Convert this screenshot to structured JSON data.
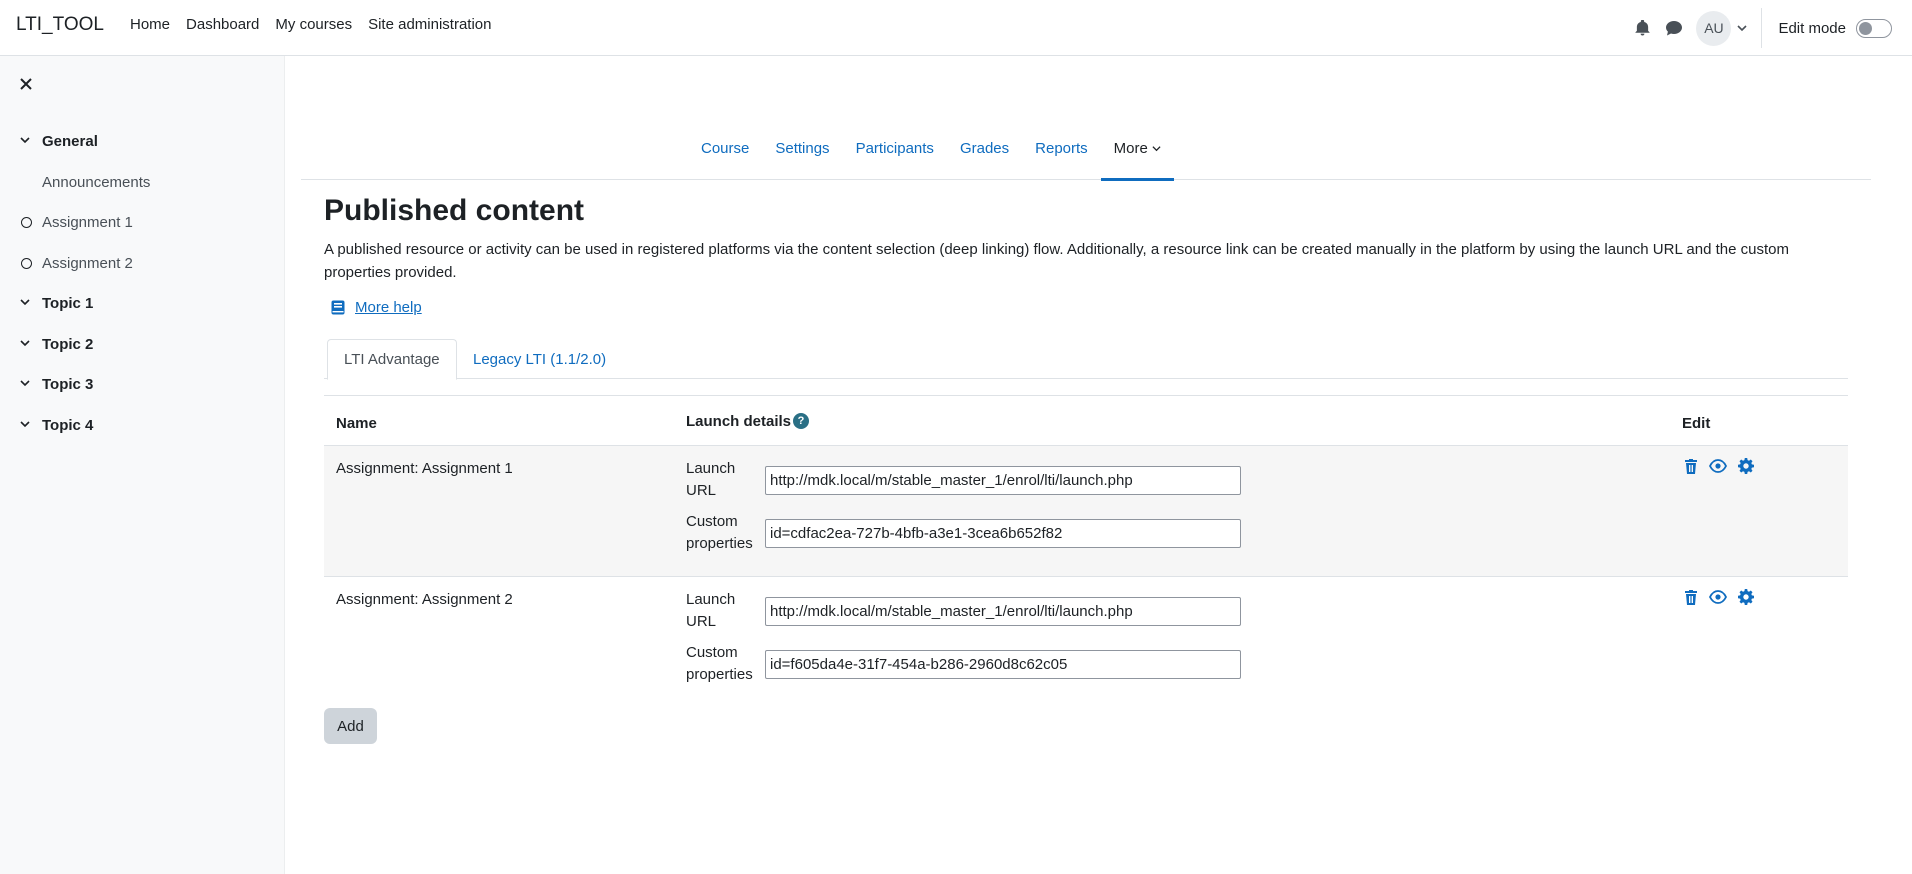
{
  "navbar": {
    "brand": "LTI_TOOL",
    "links": [
      "Home",
      "Dashboard",
      "My courses",
      "Site administration"
    ],
    "avatar_initials": "AU",
    "edit_mode_label": "Edit mode"
  },
  "drawer": {
    "sections": [
      {
        "label": "General"
      },
      {
        "label": "Topic 1"
      },
      {
        "label": "Topic 2"
      },
      {
        "label": "Topic 3"
      },
      {
        "label": "Topic 4"
      }
    ],
    "general_items": [
      "Announcements",
      "Assignment 1",
      "Assignment 2"
    ]
  },
  "secondary_nav": {
    "tabs": [
      "Course",
      "Settings",
      "Participants",
      "Grades",
      "Reports"
    ],
    "more_label": "More"
  },
  "page": {
    "title": "Published content",
    "description": "A published resource or activity can be used in registered platforms via the content selection (deep linking) flow. Additionally, a resource link can be created manually in the platform by using the launch URL and the custom properties provided.",
    "help_link": "More help"
  },
  "tabs": {
    "active": "LTI Advantage",
    "inactive": "Legacy LTI (1.1/2.0)"
  },
  "table": {
    "headers": {
      "name": "Name",
      "launch": "Launch details",
      "edit": "Edit"
    },
    "info_glyph": "?",
    "launch_url_label": "Launch URL",
    "custom_props_label": "Custom properties",
    "rows": [
      {
        "name": "Assignment: Assignment 1",
        "launch_url": "http://mdk.local/m/stable_master_1/enrol/lti/launch.php",
        "custom_properties": "id=cdfac2ea-727b-4bfb-a3e1-3cea6b652f82"
      },
      {
        "name": "Assignment: Assignment 2",
        "launch_url": "http://mdk.local/m/stable_master_1/enrol/lti/launch.php",
        "custom_properties": "id=f605da4e-31f7-454a-b286-2960d8c62c05"
      }
    ]
  },
  "add_button": "Add",
  "colors": {
    "accent": "#0f6cbf",
    "drawer_bg": "#f8f9fa",
    "row_bg": "#f6f6f6"
  },
  "icons": [
    "bell-icon",
    "chat-icon",
    "close-icon",
    "chevron-down-icon",
    "circle-icon",
    "book-icon",
    "info-icon",
    "trash-icon",
    "eye-icon",
    "gear-icon"
  ]
}
